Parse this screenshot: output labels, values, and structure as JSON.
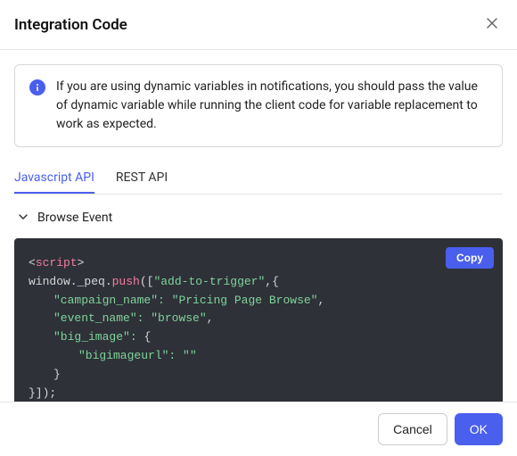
{
  "header": {
    "title": "Integration Code"
  },
  "info": {
    "text": "If you are using dynamic variables in notifications, you should pass the value of dynamic variable while running the client code for variable replacement to work as expected."
  },
  "tabs": {
    "javascript": "Javascript API",
    "rest": "REST API"
  },
  "accordion": {
    "browse_event": "Browse Event"
  },
  "code": {
    "copy_label": "Copy",
    "script_open": "script",
    "window_peq": "window._peq.",
    "push": "push",
    "open_bracket": "([",
    "add_to_trigger": "\"add-to-trigger\"",
    "comma_brace": ",{",
    "campaign_name_key": "\"campaign_name\":",
    "campaign_name_val": "\"Pricing Page Browse\"",
    "event_name_key": "\"event_name\":",
    "event_name_val": "\"browse\"",
    "big_image_key": "\"big_image\":",
    "open_brace": "{",
    "bigimageurl_key": "\"bigimageurl\":",
    "bigimageurl_val": "\"\"",
    "close_brace": "}",
    "close_all": "}]);"
  },
  "footer": {
    "cancel": "Cancel",
    "ok": "OK"
  }
}
